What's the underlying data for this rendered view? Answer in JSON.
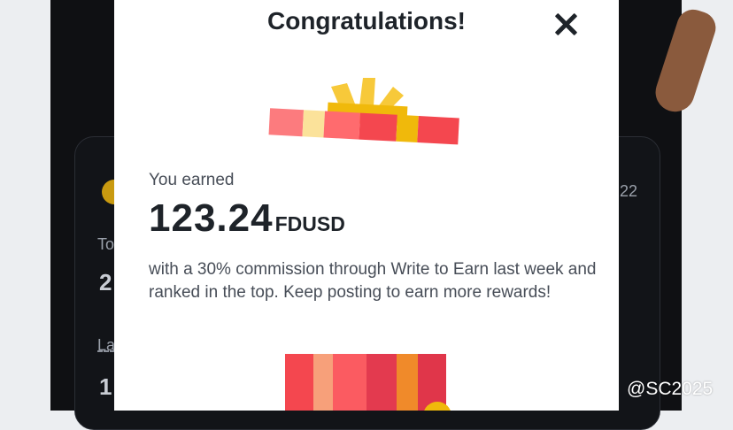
{
  "modal": {
    "title": "Congratulations!",
    "earned_label": "You earned",
    "amount": "123.24",
    "currency": "FDUSD",
    "description": "with a 30% commission through Write to Earn last week and ranked in the top. Keep posting to earn more rewards!",
    "close_icon": "close-icon"
  },
  "background": {
    "label_partial_1": "To",
    "value_partial_1": "2",
    "label_partial_2": "La",
    "value_partial_2": "1",
    "right_partial": "22"
  },
  "watermark": {
    "text": "@SC2025",
    "icon": "binance-square-logo-icon"
  },
  "colors": {
    "modal_bg": "#ffffff",
    "text_primary": "#1e2329",
    "text_secondary": "#474d57",
    "gift_red": "#f4474f",
    "gift_gold": "#f0b90b"
  }
}
